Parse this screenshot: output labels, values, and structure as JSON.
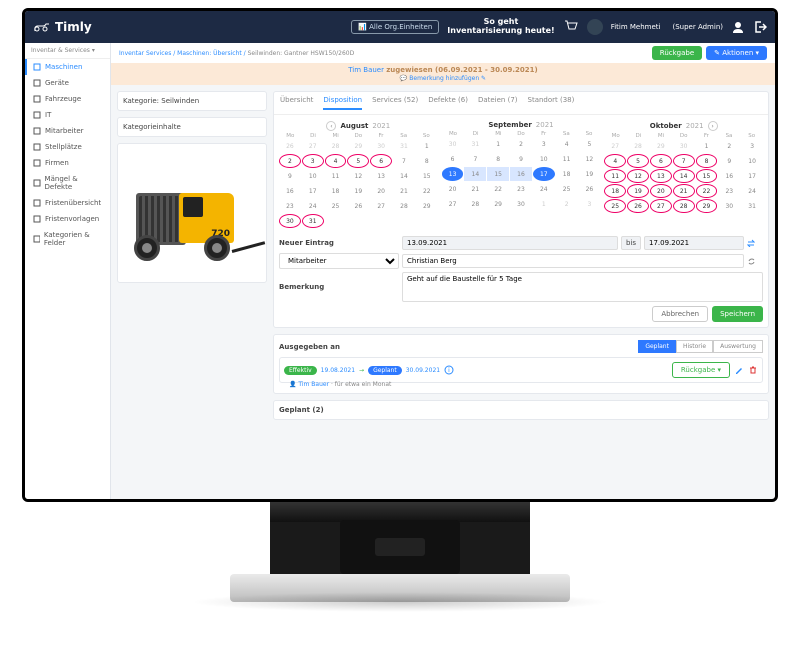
{
  "brand": "Timly",
  "top": {
    "orgBtn": "Alle Org.Einheiten",
    "msg1": "So geht",
    "msg2": "Inventarisierung heute!",
    "userName": "Fitim Mehmeti",
    "userRole": "(Super Admin)"
  },
  "sidebar": {
    "head": "Inventar & Services",
    "items": [
      {
        "label": "Maschinen",
        "active": true
      },
      {
        "label": "Geräte"
      },
      {
        "label": "Fahrzeuge"
      },
      {
        "label": "IT"
      },
      {
        "label": "Mitarbeiter"
      },
      {
        "label": "Stellplätze"
      },
      {
        "label": "Firmen"
      },
      {
        "label": "Mängel & Defekte"
      },
      {
        "label": "Fristenübersicht"
      },
      {
        "label": "Fristenvorlagen"
      },
      {
        "label": "Kategorien & Felder"
      }
    ]
  },
  "crumbs": {
    "a": "Inventar Services",
    "b": "Maschinen: Übersicht",
    "c": "Seilwinden: Gantner HSW150/260D"
  },
  "btns": {
    "return": "Rückgabe",
    "actions": "✎ Aktionen ▾"
  },
  "banner": {
    "user": "Tim Bauer",
    "txt": "zugewiesen (06.09.2021 - 30.09.2021)",
    "link": "Bemerkung hinzufügen ✎"
  },
  "left": {
    "cat": "Kategorie: Seilwinden",
    "catContent": "Kategorieinhalte"
  },
  "tabs": [
    {
      "label": "Übersicht"
    },
    {
      "label": "Disposition",
      "active": true
    },
    {
      "label": "Services (52)"
    },
    {
      "label": "Defekte (6)"
    },
    {
      "label": "Dateien (7)"
    },
    {
      "label": "Standort (38)"
    }
  ],
  "weekdays": [
    "Mo",
    "Di",
    "Mi",
    "Do",
    "Fr",
    "Sa",
    "So"
  ],
  "months": [
    {
      "name": "August",
      "year": "2021",
      "grid": [
        {
          "d": 26,
          "c": "dim"
        },
        {
          "d": 27,
          "c": "dim"
        },
        {
          "d": 28,
          "c": "dim"
        },
        {
          "d": 29,
          "c": "dim"
        },
        {
          "d": 30,
          "c": "dim"
        },
        {
          "d": 31,
          "c": "dim"
        },
        {
          "d": 1
        },
        {
          "d": 2,
          "c": "ring"
        },
        {
          "d": 3,
          "c": "ring"
        },
        {
          "d": 4,
          "c": "ring"
        },
        {
          "d": 5,
          "c": "ring"
        },
        {
          "d": 6,
          "c": "ring"
        },
        {
          "d": 7
        },
        {
          "d": 8
        },
        {
          "d": 9
        },
        {
          "d": 10
        },
        {
          "d": 11
        },
        {
          "d": 12
        },
        {
          "d": 13
        },
        {
          "d": 14
        },
        {
          "d": 15
        },
        {
          "d": 16
        },
        {
          "d": 17
        },
        {
          "d": 18
        },
        {
          "d": 19
        },
        {
          "d": 20
        },
        {
          "d": 21
        },
        {
          "d": 22
        },
        {
          "d": 23
        },
        {
          "d": 24
        },
        {
          "d": 25
        },
        {
          "d": 26
        },
        {
          "d": 27
        },
        {
          "d": 28
        },
        {
          "d": 29
        },
        {
          "d": 30,
          "c": "ring"
        },
        {
          "d": 31,
          "c": "ring"
        }
      ]
    },
    {
      "name": "September",
      "year": "2021",
      "grid": [
        {
          "d": 30,
          "c": "dim"
        },
        {
          "d": 31,
          "c": "dim"
        },
        {
          "d": 1
        },
        {
          "d": 2
        },
        {
          "d": 3
        },
        {
          "d": 4
        },
        {
          "d": 5
        },
        {
          "d": 6
        },
        {
          "d": 7
        },
        {
          "d": 8
        },
        {
          "d": 9
        },
        {
          "d": 10
        },
        {
          "d": 11
        },
        {
          "d": 12
        },
        {
          "d": 13,
          "c": "sel"
        },
        {
          "d": 14,
          "c": "selR"
        },
        {
          "d": 15,
          "c": "selR"
        },
        {
          "d": 16,
          "c": "selR"
        },
        {
          "d": 17,
          "c": "sel"
        },
        {
          "d": 18
        },
        {
          "d": 19
        },
        {
          "d": 20
        },
        {
          "d": 21
        },
        {
          "d": 22
        },
        {
          "d": 23
        },
        {
          "d": 24
        },
        {
          "d": 25
        },
        {
          "d": 26
        },
        {
          "d": 27
        },
        {
          "d": 28
        },
        {
          "d": 29
        },
        {
          "d": 30
        },
        {
          "d": 1,
          "c": "dim"
        },
        {
          "d": 2,
          "c": "dim"
        },
        {
          "d": 3,
          "c": "dim"
        }
      ]
    },
    {
      "name": "Oktober",
      "year": "2021",
      "grid": [
        {
          "d": 27,
          "c": "dim"
        },
        {
          "d": 28,
          "c": "dim"
        },
        {
          "d": 29,
          "c": "dim"
        },
        {
          "d": 30,
          "c": "dim"
        },
        {
          "d": 1
        },
        {
          "d": 2
        },
        {
          "d": 3
        },
        {
          "d": 4,
          "c": "ring"
        },
        {
          "d": 5,
          "c": "ring"
        },
        {
          "d": 6,
          "c": "ring"
        },
        {
          "d": 7,
          "c": "ring"
        },
        {
          "d": 8,
          "c": "ring"
        },
        {
          "d": 9
        },
        {
          "d": 10
        },
        {
          "d": 11,
          "c": "ring"
        },
        {
          "d": 12,
          "c": "ring"
        },
        {
          "d": 13,
          "c": "ring"
        },
        {
          "d": 14,
          "c": "ring"
        },
        {
          "d": 15,
          "c": "ring"
        },
        {
          "d": 16
        },
        {
          "d": 17
        },
        {
          "d": 18,
          "c": "ring"
        },
        {
          "d": 19,
          "c": "ring"
        },
        {
          "d": 20,
          "c": "ring"
        },
        {
          "d": 21,
          "c": "ring"
        },
        {
          "d": 22,
          "c": "ring"
        },
        {
          "d": 23
        },
        {
          "d": 24
        },
        {
          "d": 25,
          "c": "ring"
        },
        {
          "d": 26,
          "c": "ring"
        },
        {
          "d": 27,
          "c": "ring"
        },
        {
          "d": 28,
          "c": "ring"
        },
        {
          "d": 29,
          "c": "ring"
        },
        {
          "d": 30
        },
        {
          "d": 31
        }
      ]
    }
  ],
  "form": {
    "newEntry": "Neuer Eintrag",
    "date1": "13.09.2021",
    "bis": "bis",
    "date2": "17.09.2021",
    "type": "Mitarbeiter",
    "person": "Christian Berg",
    "remarkLabel": "Bemerkung",
    "remark": "Geht auf die Baustelle für 5 Tage",
    "cancel": "Abbrechen",
    "save": "Speichern"
  },
  "assigned": {
    "head": "Ausgegeben an",
    "tabs": [
      "Geplant",
      "Historie",
      "Auswertung"
    ],
    "pill1": "Effektiv",
    "date1": "19.08.2021",
    "pill2": "Geplant",
    "date2": "30.09.2021",
    "user": "Tim Bauer",
    "dur": "für etwa ein Monat",
    "ret": "Rückgabe ▾"
  },
  "planned": "Geplant (2)"
}
